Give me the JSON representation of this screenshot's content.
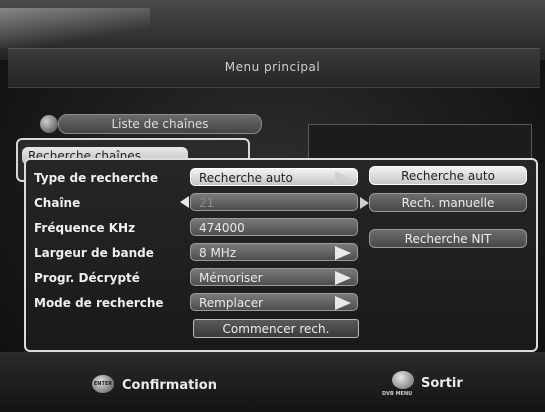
{
  "header": {
    "title": "Menu principal"
  },
  "main_menu": {
    "items": [
      {
        "label": "Liste de chaînes"
      },
      {
        "label": "Recherche chaînes"
      }
    ]
  },
  "scan_panel": {
    "rows": [
      {
        "label": "Type de recherche",
        "value": "Recherche auto"
      },
      {
        "label": "Chaîne",
        "value": "21"
      },
      {
        "label": "Fréquence KHz",
        "value": "474000"
      },
      {
        "label": "Largeur de bande",
        "value": "8 MHz"
      },
      {
        "label": "Progr. Décrypté",
        "value": "Mémoriser"
      },
      {
        "label": "Mode de recherche",
        "value": "Remplacer"
      }
    ],
    "start_button": "Commencer rech."
  },
  "type_options": [
    {
      "label": "Recherche auto",
      "selected": true
    },
    {
      "label": "Rech. manuelle",
      "selected": false
    },
    {
      "label": "Recherche NIT",
      "selected": false
    }
  ],
  "footer": {
    "enter_key": "ENTER",
    "confirm_label": "Confirmation",
    "dvb_key": "DVB MENU",
    "exit_label": "Sortir"
  }
}
